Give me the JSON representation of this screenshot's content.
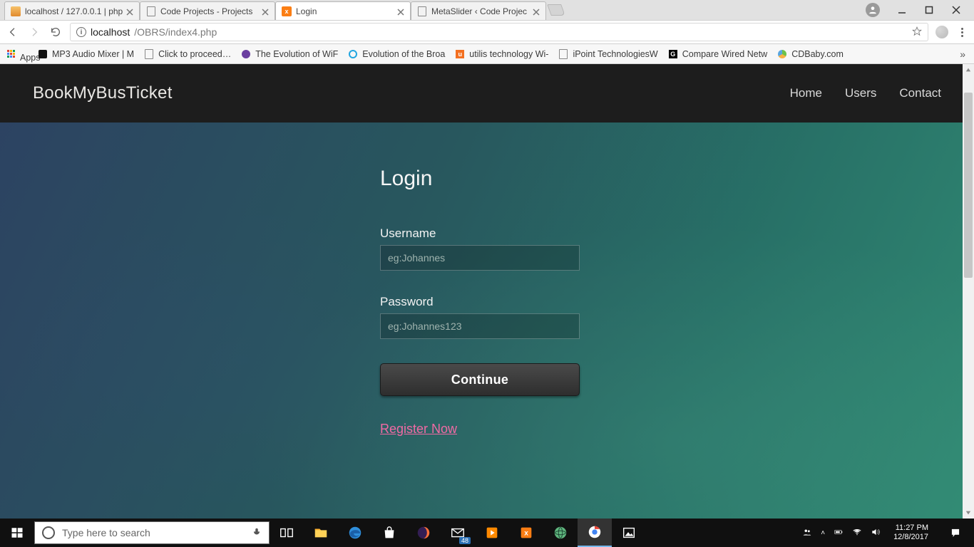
{
  "window": {
    "tabs": [
      {
        "title": "localhost / 127.0.0.1 | php"
      },
      {
        "title": "Code Projects - Projects"
      },
      {
        "title": "Login"
      },
      {
        "title": "MetaSlider ‹ Code Projec"
      }
    ],
    "active_tab_index": 2,
    "url_host": "localhost",
    "url_path": "/OBRS/index4.php"
  },
  "bookmarks": {
    "apps_label": "Apps",
    "items": [
      "MP3 Audio Mixer | M",
      "Click to proceed…",
      "The Evolution of WiF",
      "Evolution of the Broa",
      "utilis technology Wi-",
      "iPoint TechnologiesW",
      "Compare Wired Netw",
      "CDBaby.com"
    ]
  },
  "site": {
    "brand": "BookMyBusTicket",
    "nav": {
      "home": "Home",
      "users": "Users",
      "contact": "Contact"
    }
  },
  "login": {
    "heading": "Login",
    "username_label": "Username",
    "username_placeholder": "eg:Johannes",
    "password_label": "Password",
    "password_placeholder": "eg:Johannes123",
    "continue_label": "Continue",
    "register_label": "Register Now"
  },
  "taskbar": {
    "search_placeholder": "Type here to search",
    "badge": "48",
    "time": "11:27 PM",
    "date": "12/8/2017"
  }
}
